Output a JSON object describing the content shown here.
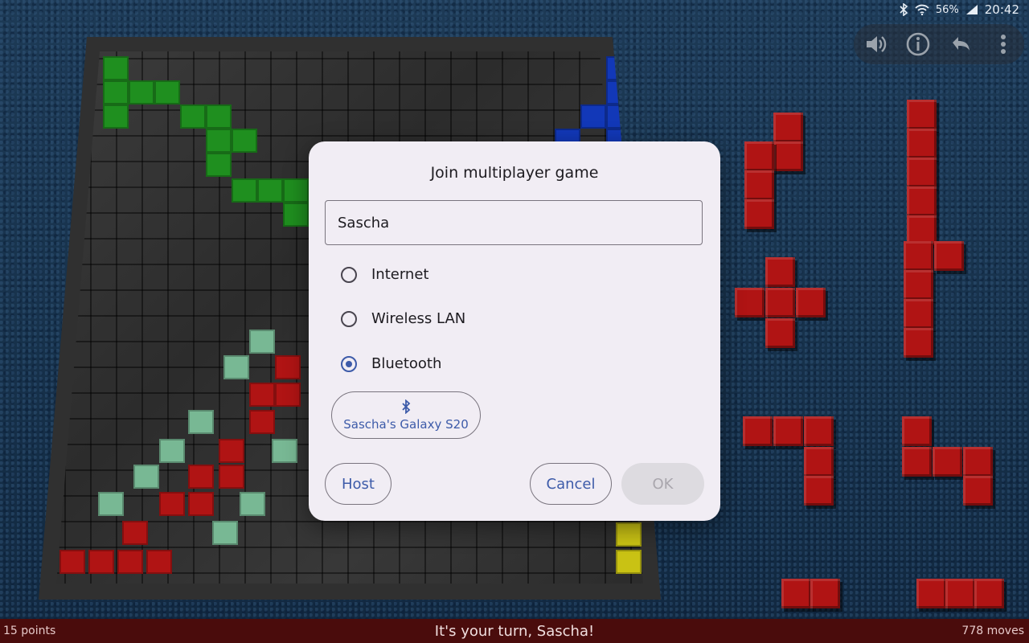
{
  "status_bar": {
    "battery": "56%",
    "time": "20:42"
  },
  "toolbar": {
    "icons": [
      "volume-icon",
      "info-icon",
      "undo-icon",
      "more-vert-icon"
    ]
  },
  "dialog": {
    "title": "Join multiplayer game",
    "name_value": "Sascha",
    "options": [
      {
        "label": "Internet",
        "selected": false
      },
      {
        "label": "Wireless LAN",
        "selected": false
      },
      {
        "label": "Bluetooth",
        "selected": true
      }
    ],
    "device_label": "Sascha's Galaxy S20",
    "host_label": "Host",
    "cancel_label": "Cancel",
    "ok_label": "OK"
  },
  "bottom_bar": {
    "points": "15 points",
    "turn_message": "It's your turn, Sascha!",
    "moves": "778 moves"
  },
  "colors": {
    "green": "#1f8f1f",
    "blue": "#1238b8",
    "red": "#b01414",
    "pale_green": "#78b894",
    "yellow": "#c9c214"
  }
}
